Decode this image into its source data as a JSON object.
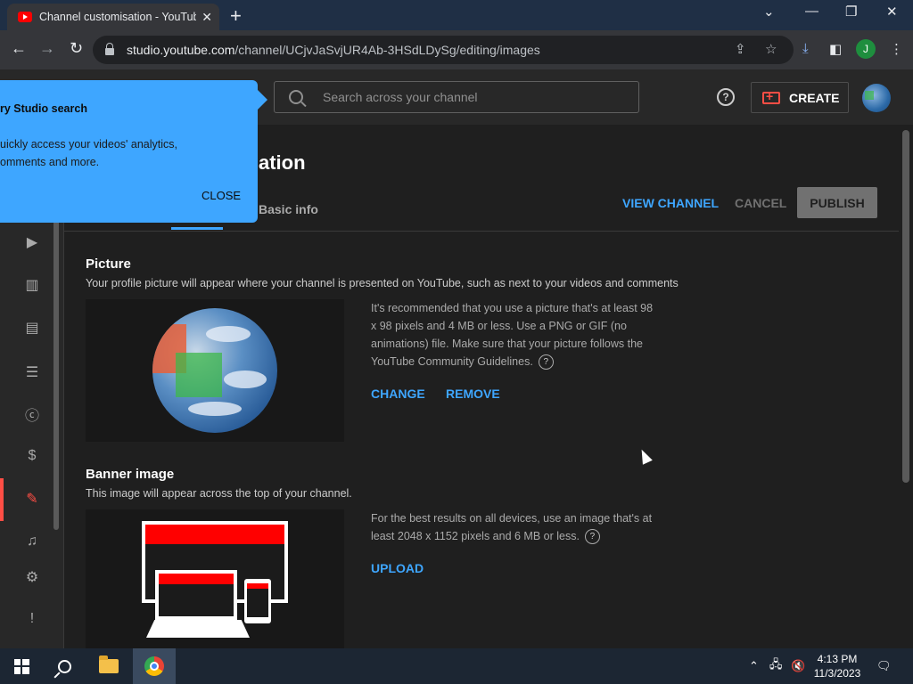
{
  "browser": {
    "tab_title": "Channel customisation - YouTube Studio",
    "url_host": "studio.youtube.com",
    "url_path": "/channel/UCjvJaSvjUR4Ab-3HSdLDySg/editing/images",
    "profile_initial": "J"
  },
  "header": {
    "search_placeholder": "Search across your channel",
    "create_label": "CREATE"
  },
  "popup": {
    "title": "ry Studio search",
    "body_line1": "uickly access your videos' analytics,",
    "body_line2": "omments and more.",
    "close_label": "CLOSE"
  },
  "page": {
    "title": "ation",
    "tab_basic_info": "Basic info",
    "view_channel": "VIEW CHANNEL",
    "cancel": "CANCEL",
    "publish": "PUBLISH"
  },
  "picture": {
    "heading": "Picture",
    "description": "Your profile picture will appear where your channel is presented on YouTube, such as next to your videos and comments",
    "info_line1": "It's recommended that you use a picture that's at least 98",
    "info_line2": "x 98 pixels and 4 MB or less. Use a PNG or GIF (no",
    "info_line3": "animations) file. Make sure that your picture follows the",
    "info_line4": "YouTube Community Guidelines.",
    "change_label": "CHANGE",
    "remove_label": "REMOVE"
  },
  "banner": {
    "heading": "Banner image",
    "description": "This image will appear across the top of your channel.",
    "info_line1": "For the best results on all devices, use an image that's at",
    "info_line2": "least 2048 x 1152 pixels and 6 MB or less.",
    "upload_label": "UPLOAD"
  },
  "taskbar": {
    "time": "4:13 PM",
    "date": "11/3/2023"
  },
  "colors": {
    "accent_blue": "#3ea6ff",
    "youtube_red": "#ff0000",
    "active_red": "#ff4e45"
  }
}
